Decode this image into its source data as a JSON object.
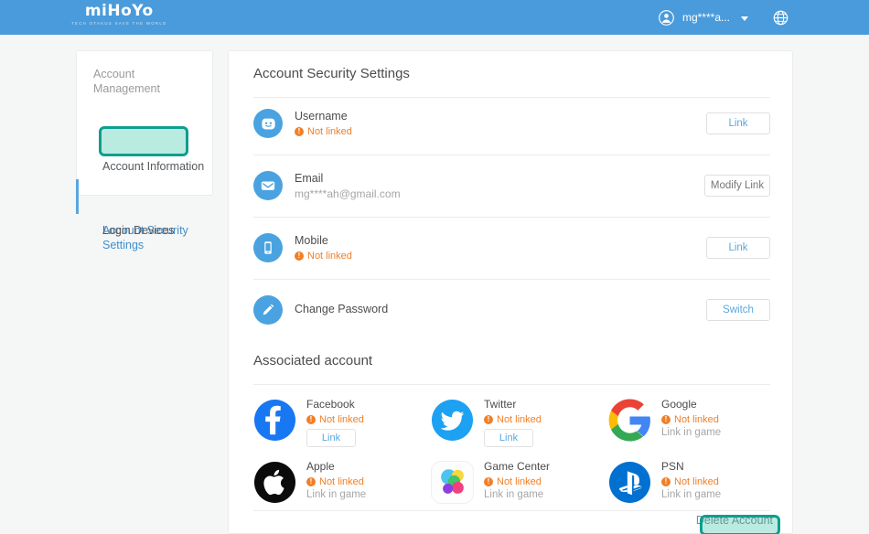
{
  "header": {
    "logo_text": "miHoYo",
    "logo_tagline": "TECH OTAKUS SAVE THE WORLD",
    "user_name": "mg****a...",
    "avatar_icon": "user-avatar-icon",
    "dropdown_icon": "chevron-down-icon",
    "language_icon": "globe-icon",
    "bg_color": "#4a9bdb"
  },
  "sidebar": {
    "title": "Account\nManagement",
    "title_line1": "Account",
    "title_line2": "Management",
    "items": [
      {
        "label": "Account Information",
        "active": false
      },
      {
        "label": "Account Security\nSettings",
        "active": true
      },
      {
        "label": "Login Devices",
        "active": false
      }
    ],
    "item0_label": "Account Information",
    "item1_line1": "Account Security",
    "item1_line2": "Settings",
    "item2_label": "Login Devices",
    "active_color": "#3f8fcd",
    "highlight_color": "#0e9e8f"
  },
  "main": {
    "security_title": "Account Security Settings",
    "associated_title": "Associated account",
    "delete_account_label": "Delete Account",
    "security_rows": [
      {
        "icon": "smiley-face-icon",
        "label": "Username",
        "status": "Not linked",
        "sub": "",
        "button": "Link",
        "button_style": "blue"
      },
      {
        "icon": "envelope-icon",
        "label": "Email",
        "status": "",
        "sub": "mg****ah@gmail.com",
        "button": "Modify Link",
        "button_style": "gray"
      },
      {
        "icon": "mobile-phone-icon",
        "label": "Mobile",
        "status": "Not linked",
        "sub": "",
        "button": "Link",
        "button_style": "blue"
      },
      {
        "icon": "pencil-icon",
        "label": "Change Password",
        "status": "",
        "sub": "",
        "button": "Switch",
        "button_style": "blue"
      }
    ],
    "associated_accounts": [
      {
        "icon": "facebook-icon",
        "name": "Facebook",
        "status": "Not linked",
        "button": "Link",
        "ingame": ""
      },
      {
        "icon": "twitter-icon",
        "name": "Twitter",
        "status": "Not linked",
        "button": "Link",
        "ingame": ""
      },
      {
        "icon": "google-icon",
        "name": "Google",
        "status": "Not linked",
        "button": "",
        "ingame": "Link in game"
      },
      {
        "icon": "apple-icon",
        "name": "Apple",
        "status": "Not linked",
        "button": "",
        "ingame": "Link in game"
      },
      {
        "icon": "game-center-icon",
        "name": "Game Center",
        "status": "Not linked",
        "button": "",
        "ingame": "Link in game"
      },
      {
        "icon": "psn-icon",
        "name": "PSN",
        "status": "Not linked",
        "button": "",
        "ingame": "Link in game"
      }
    ],
    "warning_color": "#f07f28",
    "link_color": "#5aa7de"
  }
}
